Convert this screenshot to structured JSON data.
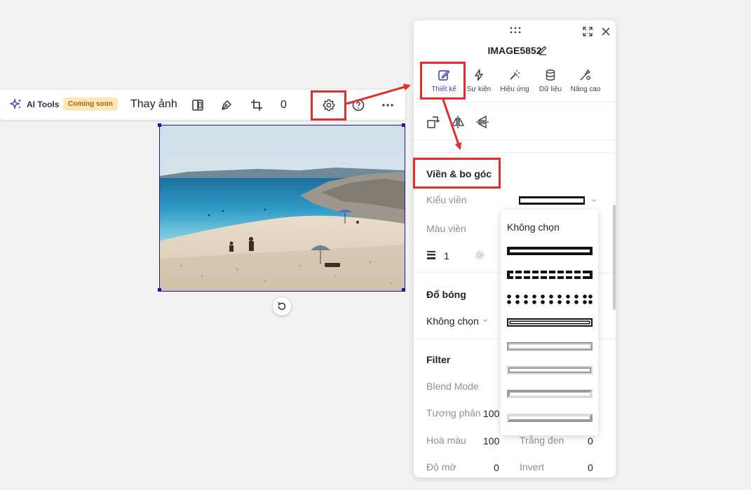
{
  "toolbar": {
    "ai_tools_label": "AI Tools",
    "coming_soon_badge": "Coming soon",
    "replace_image_label": "Thay ảnh",
    "counter_value": "0",
    "icons": [
      "sparkle-icon",
      "flip-icon",
      "pen-icon",
      "crop-icon",
      "gear-icon",
      "help-icon",
      "more-icon"
    ]
  },
  "panel": {
    "title": "IMAGE5852",
    "tabs": [
      {
        "label": "Thiết kế",
        "icon": "edit-icon",
        "active": true
      },
      {
        "label": "Sự kiện",
        "icon": "lightning-icon",
        "active": false
      },
      {
        "label": "Hiệu ứng",
        "icon": "magic-wand-icon",
        "active": false
      },
      {
        "label": "Dữ liệu",
        "icon": "database-icon",
        "active": false
      },
      {
        "label": "Nâng cao",
        "icon": "advanced-icon",
        "active": false
      }
    ],
    "border_section": {
      "title": "Viền & bo góc",
      "border_style_label": "Kiểu viền",
      "border_color_label": "Màu viền",
      "border_width_value": "1"
    },
    "shadow_section": {
      "title": "Đổ bóng",
      "shadow_value": "Không chọn"
    },
    "filter_section": {
      "title": "Filter",
      "blend_mode_label": "Blend Mode",
      "contrast_label": "Tương phản",
      "contrast_value": "100",
      "hue_label": "Hoà màu",
      "hue_value": "100",
      "grayscale_label": "Trắng đen",
      "grayscale_value": "0",
      "blur_label": "Độ mờ",
      "blur_value": "0",
      "invert_label": "Invert",
      "invert_value": "0"
    }
  },
  "dropdown": {
    "none_label": "Không chọn",
    "options": [
      "solid",
      "dashed",
      "dotted",
      "double",
      "groove",
      "ridge",
      "inset",
      "outset"
    ]
  },
  "colors": {
    "accent": "#3b3bb5",
    "highlight": "#e52c2c",
    "selection": "#1a1a9c"
  }
}
